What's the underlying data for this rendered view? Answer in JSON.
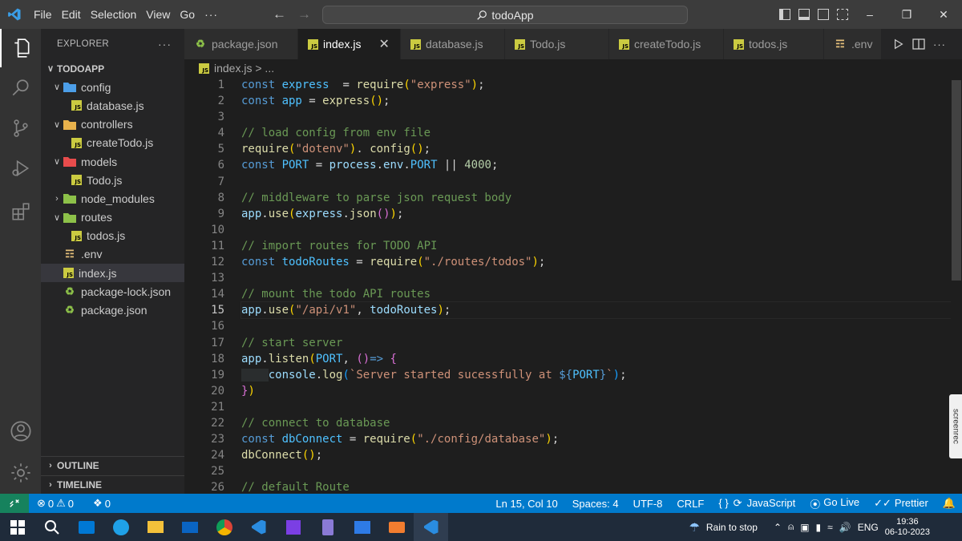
{
  "titlebar": {
    "menu": [
      "File",
      "Edit",
      "Selection",
      "View",
      "Go"
    ],
    "more": "···",
    "search_text": "todoApp"
  },
  "explorer": {
    "header": "EXPLORER",
    "more": "···",
    "project": "TODOAPP",
    "tree": [
      {
        "label": "config",
        "depth": 1,
        "type": "folder-open",
        "icon": "config-folder-icon",
        "color": "#4c9ee8"
      },
      {
        "label": "database.js",
        "depth": 2,
        "type": "js"
      },
      {
        "label": "controllers",
        "depth": 1,
        "type": "folder-open",
        "icon": "controllers-folder-icon",
        "color": "#e8b24c"
      },
      {
        "label": "createTodo.js",
        "depth": 2,
        "type": "js"
      },
      {
        "label": "models",
        "depth": 1,
        "type": "folder-open",
        "icon": "models-folder-icon",
        "color": "#e84c4c"
      },
      {
        "label": "Todo.js",
        "depth": 2,
        "type": "js"
      },
      {
        "label": "node_modules",
        "depth": 1,
        "type": "folder-closed",
        "icon": "node-modules-folder-icon",
        "color": "#8dc149"
      },
      {
        "label": "routes",
        "depth": 1,
        "type": "folder-open",
        "icon": "routes-folder-icon",
        "color": "#8dc149"
      },
      {
        "label": "todos.js",
        "depth": 2,
        "type": "js"
      },
      {
        "label": ".env",
        "depth": 1,
        "type": "env"
      },
      {
        "label": "index.js",
        "depth": 1,
        "type": "js",
        "selected": true
      },
      {
        "label": "package-lock.json",
        "depth": 1,
        "type": "json"
      },
      {
        "label": "package.json",
        "depth": 1,
        "type": "json"
      }
    ],
    "outline": "OUTLINE",
    "timeline": "TIMELINE"
  },
  "tabs": [
    {
      "label": "package.json",
      "type": "json"
    },
    {
      "label": "index.js",
      "type": "js",
      "active": true
    },
    {
      "label": "database.js",
      "type": "js"
    },
    {
      "label": "Todo.js",
      "type": "js"
    },
    {
      "label": "createTodo.js",
      "type": "js"
    },
    {
      "label": "todos.js",
      "type": "js"
    },
    {
      "label": ".env",
      "type": "env"
    }
  ],
  "breadcrumb": "index.js > ...",
  "editor": {
    "active_line": 15,
    "lines": [
      [
        [
          "kw",
          "const "
        ],
        [
          "co",
          "express"
        ],
        [
          "",
          "  = "
        ],
        [
          "fn",
          "require"
        ],
        [
          "pb",
          "("
        ],
        [
          "st",
          "\"express\""
        ],
        [
          "pb",
          ")"
        ],
        [
          "",
          ";"
        ]
      ],
      [
        [
          "kw",
          "const "
        ],
        [
          "co",
          "app"
        ],
        [
          "",
          " = "
        ],
        [
          "fn",
          "express"
        ],
        [
          "pb",
          "()"
        ],
        [
          "",
          ";"
        ]
      ],
      [],
      [
        [
          "cm",
          "// load config from env file"
        ]
      ],
      [
        [
          "fn",
          "require"
        ],
        [
          "pb",
          "("
        ],
        [
          "st",
          "\"dotenv\""
        ],
        [
          "pb",
          ")"
        ],
        [
          "",
          ". "
        ],
        [
          "fn",
          "config"
        ],
        [
          "pb",
          "()"
        ],
        [
          "",
          ";"
        ]
      ],
      [
        [
          "kw",
          "const "
        ],
        [
          "co",
          "PORT"
        ],
        [
          "",
          " = "
        ],
        [
          "va",
          "process"
        ],
        [
          "",
          "."
        ],
        [
          "va",
          "env"
        ],
        [
          "",
          "."
        ],
        [
          "co",
          "PORT"
        ],
        [
          "",
          " || "
        ],
        [
          "nu",
          "4000"
        ],
        [
          "",
          ";"
        ]
      ],
      [],
      [
        [
          "cm",
          "// middleware to parse json request body"
        ]
      ],
      [
        [
          "va",
          "app"
        ],
        [
          "",
          "."
        ],
        [
          "fn",
          "use"
        ],
        [
          "pb",
          "("
        ],
        [
          "va",
          "express"
        ],
        [
          "",
          "."
        ],
        [
          "fn",
          "json"
        ],
        [
          "pa",
          "()"
        ],
        [
          "pb",
          ")"
        ],
        [
          "",
          ";"
        ]
      ],
      [],
      [
        [
          "cm",
          "// import routes for TODO API"
        ]
      ],
      [
        [
          "kw",
          "const "
        ],
        [
          "co",
          "todoRoutes"
        ],
        [
          "",
          " = "
        ],
        [
          "fn",
          "require"
        ],
        [
          "pb",
          "("
        ],
        [
          "st",
          "\"./routes/todos\""
        ],
        [
          "pb",
          ")"
        ],
        [
          "",
          ";"
        ]
      ],
      [],
      [
        [
          "cm",
          "// mount the todo API routes"
        ]
      ],
      [
        [
          "va",
          "app"
        ],
        [
          "",
          "."
        ],
        [
          "fn",
          "use"
        ],
        [
          "pb",
          "("
        ],
        [
          "st",
          "\"/api/v1\""
        ],
        [
          "",
          ", "
        ],
        [
          "va",
          "todoRoutes"
        ],
        [
          "pb",
          ")"
        ],
        [
          "",
          ";"
        ]
      ],
      [],
      [
        [
          "cm",
          "// start server"
        ]
      ],
      [
        [
          "va",
          "app"
        ],
        [
          "",
          "."
        ],
        [
          "fn",
          "listen"
        ],
        [
          "pb",
          "("
        ],
        [
          "co",
          "PORT"
        ],
        [
          "",
          ", "
        ],
        [
          "pa",
          "()"
        ],
        [
          "kw",
          "=> "
        ],
        [
          "pa",
          "{"
        ]
      ],
      [
        [
          "",
          "    "
        ],
        [
          "va",
          "console"
        ],
        [
          "",
          "."
        ],
        [
          "fn",
          "log"
        ],
        [
          "pc",
          "("
        ],
        [
          "st",
          "`Server started sucessfully at "
        ],
        [
          "kw",
          "${"
        ],
        [
          "co",
          "PORT"
        ],
        [
          "kw",
          "}"
        ],
        [
          "st",
          "`"
        ],
        [
          "pc",
          ")"
        ],
        [
          "",
          ";"
        ]
      ],
      [
        [
          "pa",
          "}"
        ],
        [
          "pb",
          ")"
        ]
      ],
      [],
      [
        [
          "cm",
          "// connect to database"
        ]
      ],
      [
        [
          "kw",
          "const "
        ],
        [
          "co",
          "dbConnect"
        ],
        [
          "",
          " = "
        ],
        [
          "fn",
          "require"
        ],
        [
          "pb",
          "("
        ],
        [
          "st",
          "\"./config/database\""
        ],
        [
          "pb",
          ")"
        ],
        [
          "",
          ";"
        ]
      ],
      [
        [
          "fn",
          "dbConnect"
        ],
        [
          "pb",
          "()"
        ],
        [
          "",
          ";"
        ]
      ],
      [],
      [
        [
          "cm",
          "// default Route"
        ]
      ]
    ]
  },
  "statusbar": {
    "errors": "0",
    "warnings": "0",
    "ports": "0",
    "position": "Ln 15, Col 10",
    "spaces": "Spaces: 4",
    "encoding": "UTF-8",
    "eol": "CRLF",
    "language": "JavaScript",
    "golive": "Go Live",
    "prettier": "Prettier"
  },
  "taskbar": {
    "weather": "Rain to stop",
    "lang": "ENG",
    "time": "19:36",
    "date": "06-10-2023"
  },
  "screenrec": "screenrec",
  "colors": {
    "accent": "#007acc",
    "remote": "#16825d"
  }
}
